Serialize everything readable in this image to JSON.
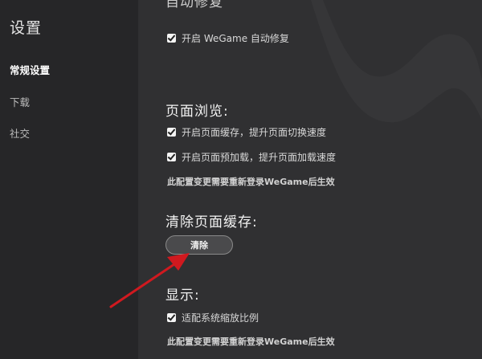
{
  "sidebar": {
    "title": "设置",
    "items": [
      {
        "label": "常规设置",
        "active": true
      },
      {
        "label": "下载",
        "active": false
      },
      {
        "label": "社交",
        "active": false
      }
    ]
  },
  "content": {
    "cut_heading": "自动修复",
    "auto_repair_option": "开启 WeGame 自动修复",
    "page_browse": {
      "heading": "页面浏览:",
      "options": [
        "开启页面缓存，提升页面切换速度",
        "开启页面预加载，提升页面加载速度"
      ],
      "note": "此配置变更需要重新登录WeGame后生效"
    },
    "clear_cache": {
      "heading": "清除页面缓存:",
      "button_label": "清除"
    },
    "display": {
      "heading": "显示:",
      "option": "适配系统缩放比例",
      "note": "此配置变更需要重新登录WeGame后生效"
    }
  },
  "colors": {
    "sidebar_bg": "#262628",
    "content_bg": "#303032",
    "annotation_arrow": "#d0191f"
  },
  "icons": [
    "checkmark-icon",
    "annotation-arrow"
  ]
}
